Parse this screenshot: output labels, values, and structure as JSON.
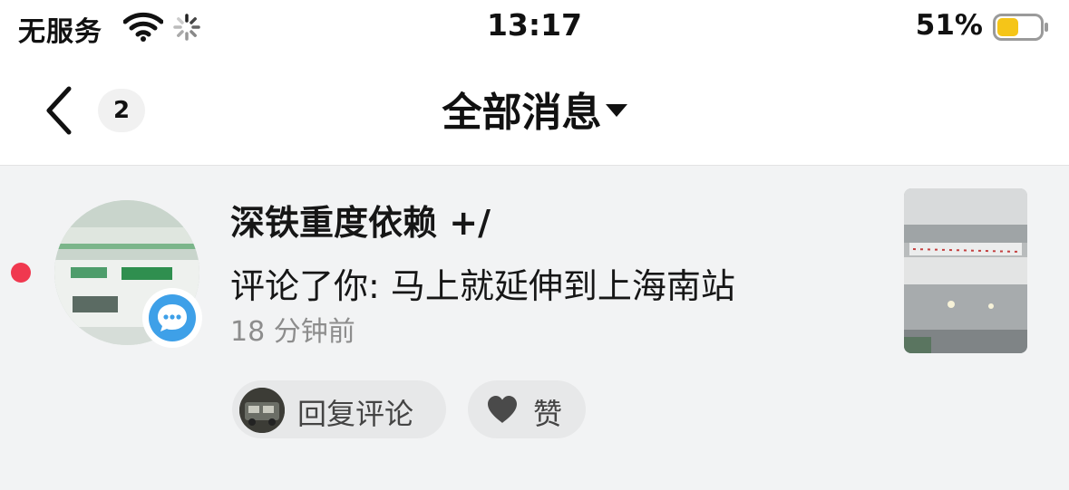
{
  "status_bar": {
    "carrier": "无服务",
    "time": "13:17",
    "battery_percent": "51%",
    "battery_level": 0.51,
    "battery_color": "#f5c518",
    "wifi_icon": "wifi-icon",
    "loading_icon": "spinner-icon"
  },
  "header": {
    "unread_count": "2",
    "title": "全部消息",
    "back_icon": "chevron-left-icon",
    "dropdown_icon": "caret-down-icon"
  },
  "message": {
    "username": "深铁重度依赖 +/",
    "comment": "评论了你: 马上就延伸到上海南站",
    "time_ago": "18 分钟前",
    "unread": true,
    "unread_dot_color": "#f0384f",
    "badge_icon": "comment-bubble-icon",
    "badge_color": "#3ea0e8",
    "actions": {
      "reply_label": "回复评论",
      "like_label": "赞",
      "like_icon": "heart-icon"
    }
  }
}
